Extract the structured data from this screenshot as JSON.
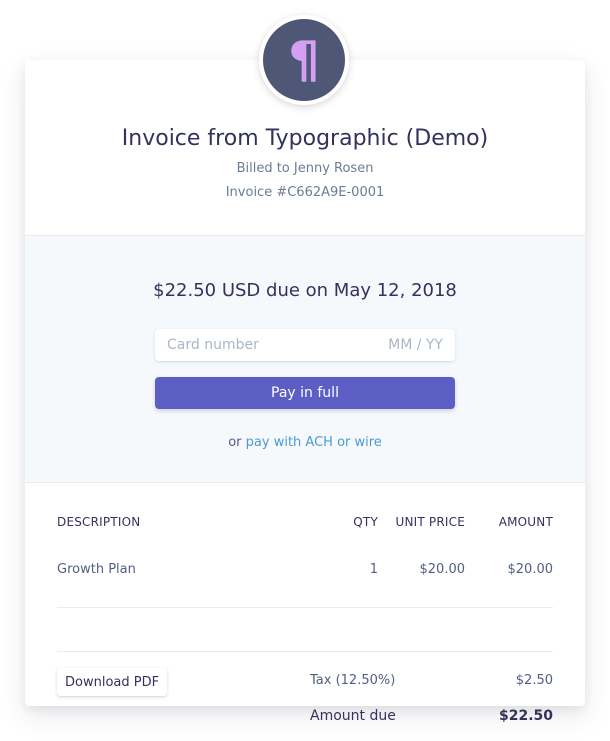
{
  "logo": {
    "glyph": "¶",
    "background": "#4f5777",
    "glyph_color": "#d39ff0"
  },
  "header": {
    "title": "Invoice from Typographic (Demo)",
    "billed_to": "Billed to Jenny Rosen",
    "invoice_number": "Invoice #C662A9E-0001"
  },
  "payment": {
    "due_text": "$22.50 USD due on May 12, 2018",
    "card_placeholder": "Card number",
    "expiry_placeholder": "MM / YY",
    "pay_button": "Pay in full",
    "alt_prefix": "or",
    "alt_link": "pay with ACH or wire",
    "button_color": "#5c5ec4",
    "link_color": "#4b9bd1"
  },
  "items": {
    "headers": {
      "description": "DESCRIPTION",
      "qty": "QTY",
      "unit_price": "UNIT PRICE",
      "amount": "AMOUNT"
    },
    "rows": [
      {
        "description": "Growth Plan",
        "qty": "1",
        "unit_price": "$20.00",
        "amount": "$20.00"
      }
    ],
    "download_button": "Download PDF",
    "tax_label": "Tax (12.50%)",
    "tax_value": "$2.50",
    "amount_due_label": "Amount due",
    "amount_due_value": "$22.50"
  }
}
